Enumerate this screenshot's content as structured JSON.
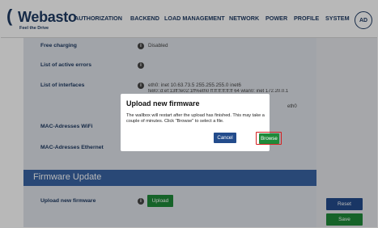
{
  "header": {
    "logo_mark": "(",
    "logo_word": "Webasto",
    "logo_tagline": "Feel the Drive",
    "nav": [
      "AUTHORIZATION",
      "BACKEND",
      "LOAD MANAGEMENT",
      "NETWORK",
      "POWER",
      "PROFILE",
      "SYSTEM"
    ],
    "avatar_initials": "AD"
  },
  "rows": [
    {
      "label": "Free charging",
      "value": "Disabled"
    },
    {
      "label": "List of active errors",
      "value": ""
    },
    {
      "label": "List of interfaces",
      "value": "eth0: inet 10.63.73.5 255.255.255.0 inet6"
    },
    {
      "label": "MAC-Adresses WiFi",
      "value": ""
    },
    {
      "label": "MAC-Adresses Ethernet",
      "value": ""
    }
  ],
  "interfaces_extra": {
    "line2": "fe80::d:ef:13ff:fe02:1ff%eth0 ff:ff:ff:ff:ff:ff 64 wlan0: inet 172.20.0.1",
    "line3": "eth0"
  },
  "firmware": {
    "section_title": "Firmware Update",
    "upload_label": "Upload new firmware",
    "upload_button": "Upload"
  },
  "right_actions": {
    "reset": "Reset",
    "save": "Save"
  },
  "info_icon_glyph": "i",
  "modal": {
    "title": "Upload new firmware",
    "body": "The wallbox will restart after the upload has finished. This may take a couple of minutes. Click \"Browse\" to select a file.",
    "cancel": "Cancel",
    "browse": "Browse"
  },
  "colors": {
    "brand_navy": "#1f3b63",
    "section_blue": "#3a64a4",
    "green": "#1f8a3a",
    "highlight_red": "#d42020"
  }
}
